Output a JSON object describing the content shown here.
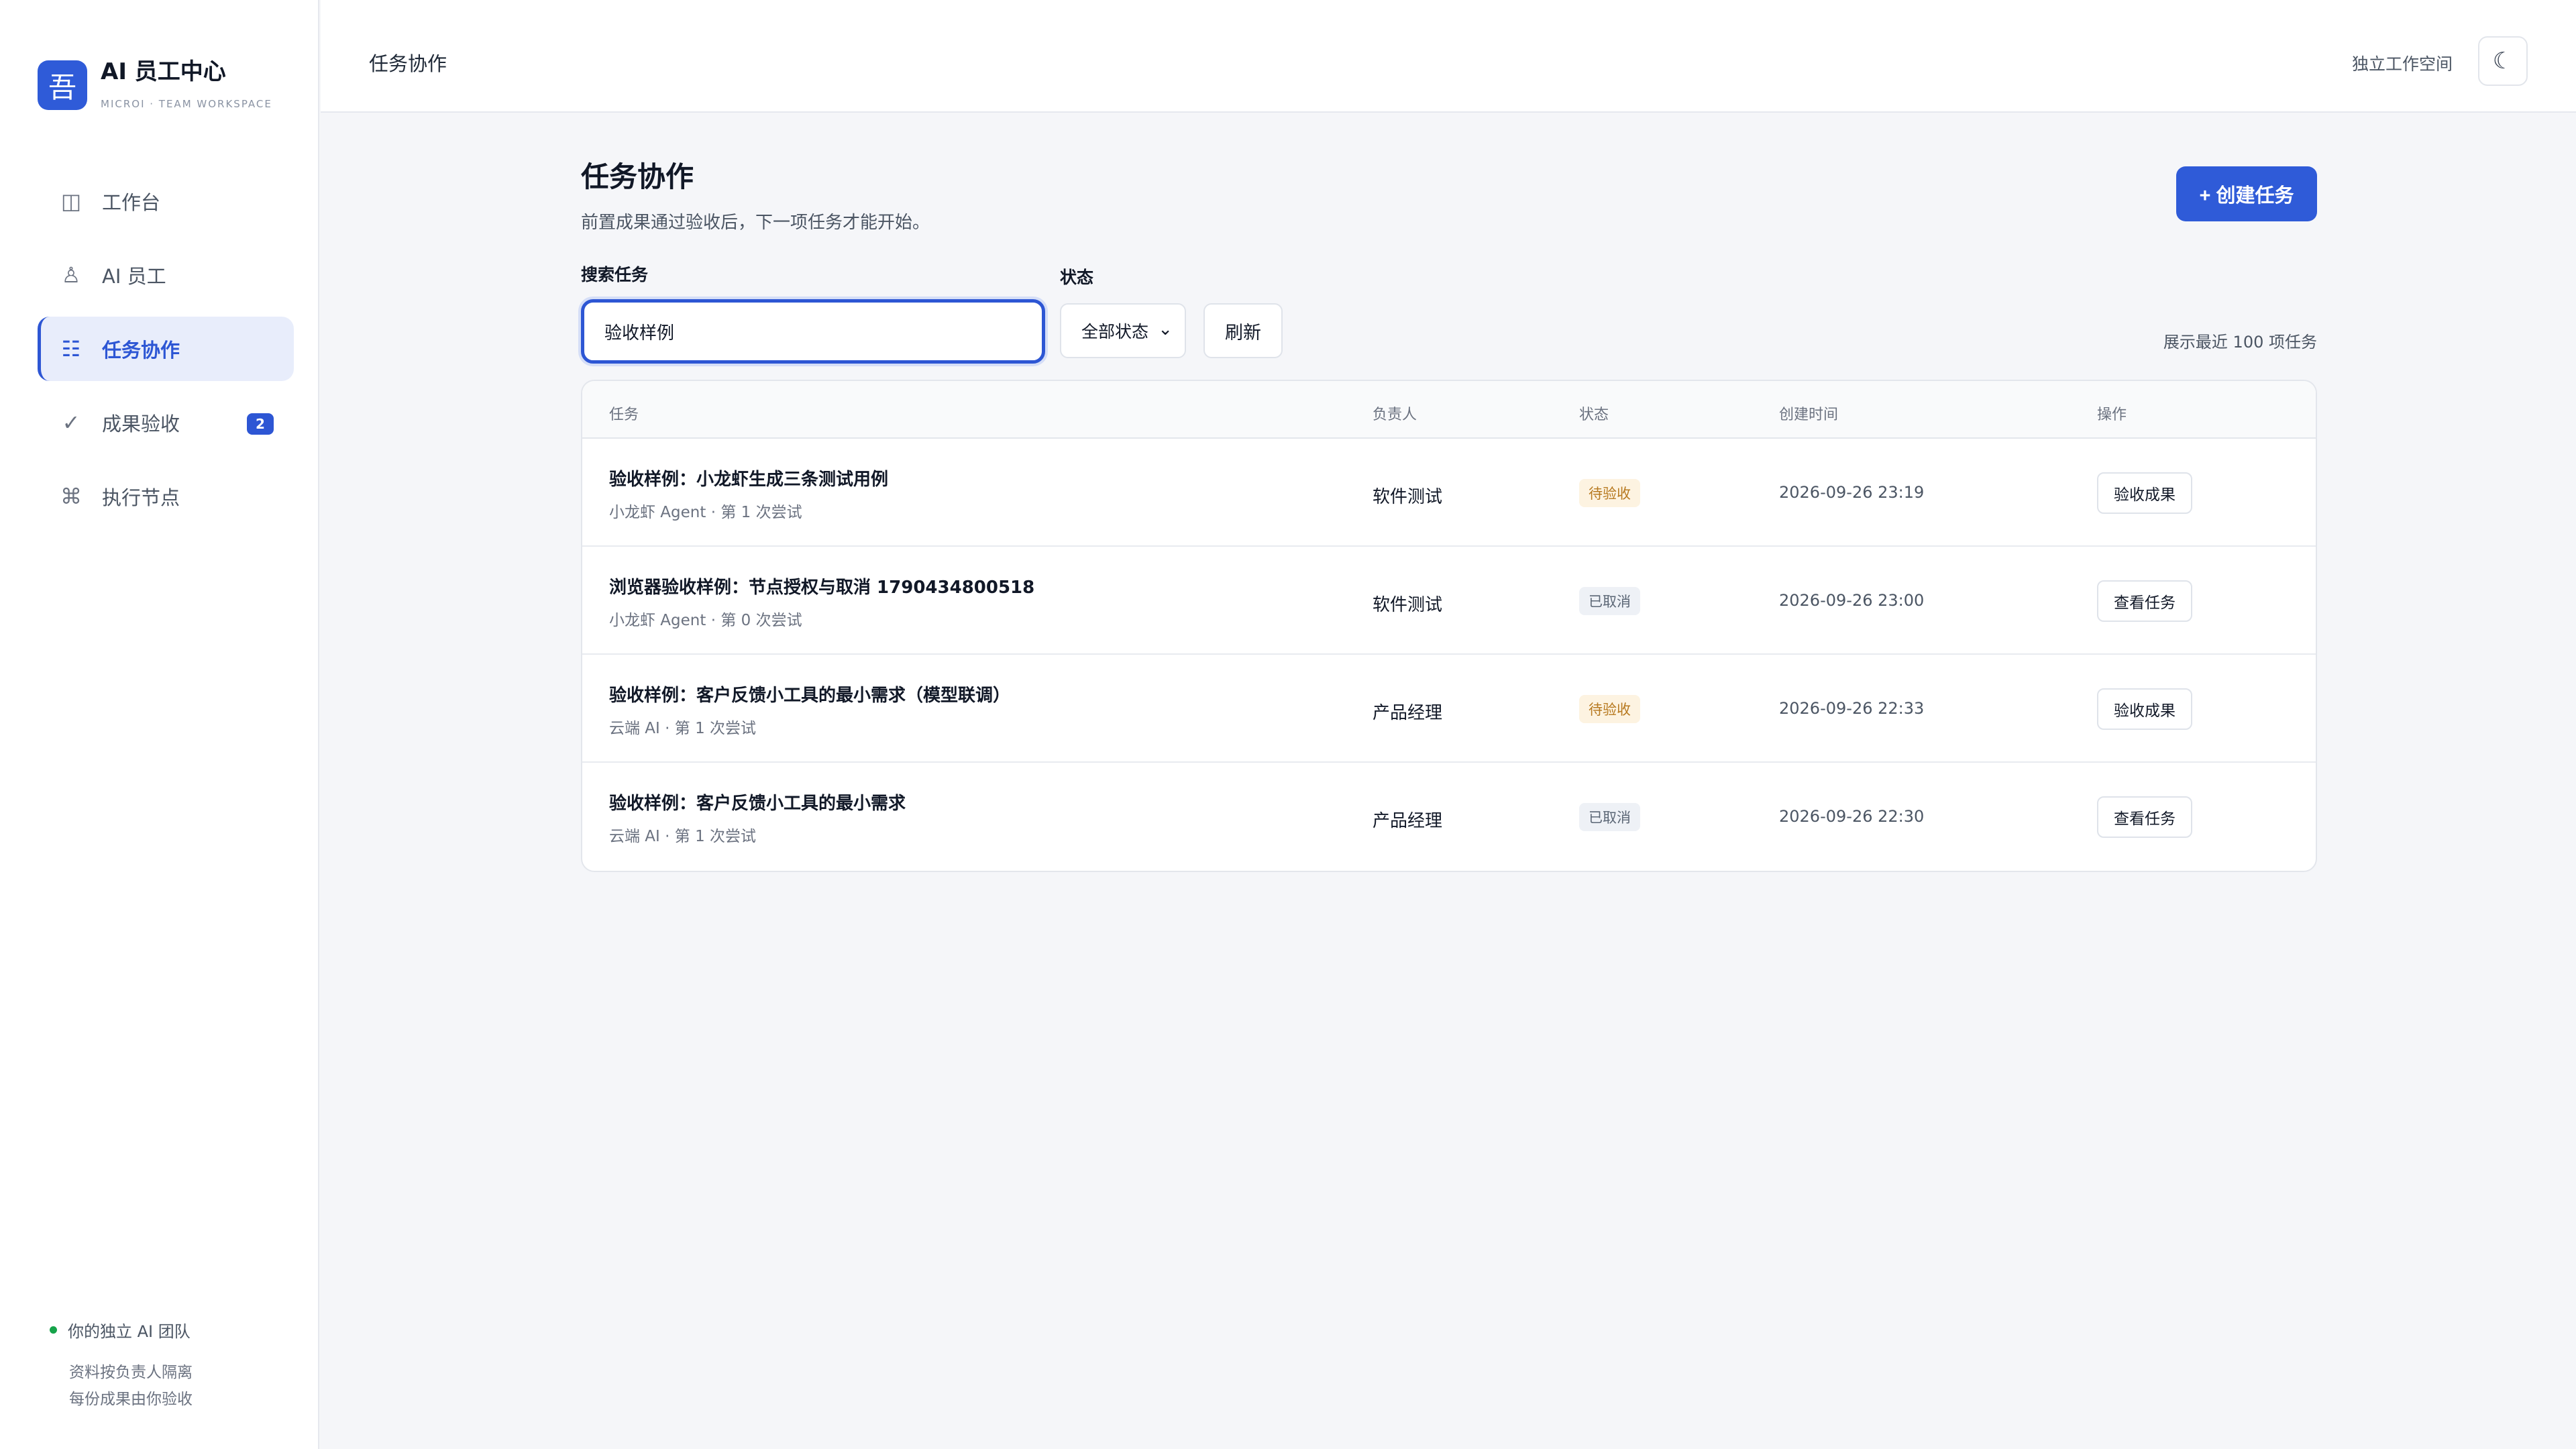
{
  "brand": {
    "logo_glyph": "吾",
    "title": "AI 员工中心",
    "subtitle": "MICROI · TEAM WORKSPACE"
  },
  "sidebar": {
    "items": [
      {
        "label": "工作台",
        "icon": "layout-icon",
        "glyph": "◫",
        "active": false
      },
      {
        "label": "AI 员工",
        "icon": "person-icon",
        "glyph": "♙",
        "active": false
      },
      {
        "label": "任务协作",
        "icon": "list-icon",
        "glyph": "☷",
        "active": true
      },
      {
        "label": "成果验收",
        "icon": "check-icon",
        "glyph": "✓",
        "active": false,
        "badge": "2"
      },
      {
        "label": "执行节点",
        "icon": "command-icon",
        "glyph": "⌘",
        "active": false
      }
    ],
    "footer": {
      "title": "你的独立 AI 团队",
      "line1": "资料按负责人隔离",
      "line2": "每份成果由你验收"
    }
  },
  "header": {
    "title": "任务协作",
    "workspace": "独立工作空间",
    "theme_glyph": "☾"
  },
  "page": {
    "title": "任务协作",
    "description": "前置成果通过验收后，下一项任务才能开始。",
    "create_label": "+ 创建任务"
  },
  "filters": {
    "search_label": "搜索任务",
    "search_value": "验收样例",
    "status_label": "状态",
    "status_value": "全部状态",
    "refresh_label": "刷新",
    "count_note": "展示最近 100 项任务"
  },
  "table": {
    "columns": [
      "任务",
      "负责人",
      "状态",
      "创建时间",
      "操作"
    ],
    "rows": [
      {
        "title": "验收样例：小龙虾生成三条测试用例",
        "sub": "小龙虾 Agent · 第 1 次尝试",
        "owner": "软件测试",
        "status": "待验收",
        "status_kind": "pending",
        "time": "2026-09-26 23:19",
        "action": "验收成果"
      },
      {
        "title": "浏览器验收样例：节点授权与取消 1790434800518",
        "sub": "小龙虾 Agent · 第 0 次尝试",
        "owner": "软件测试",
        "status": "已取消",
        "status_kind": "cancel",
        "time": "2026-09-26 23:00",
        "action": "查看任务"
      },
      {
        "title": "验收样例：客户反馈小工具的最小需求（模型联调）",
        "sub": "云端 AI · 第 1 次尝试",
        "owner": "产品经理",
        "status": "待验收",
        "status_kind": "pending",
        "time": "2026-09-26 22:33",
        "action": "验收成果"
      },
      {
        "title": "验收样例：客户反馈小工具的最小需求",
        "sub": "云端 AI · 第 1 次尝试",
        "owner": "产品经理",
        "status": "已取消",
        "status_kind": "cancel",
        "time": "2026-09-26 22:30",
        "action": "查看任务"
      }
    ]
  }
}
